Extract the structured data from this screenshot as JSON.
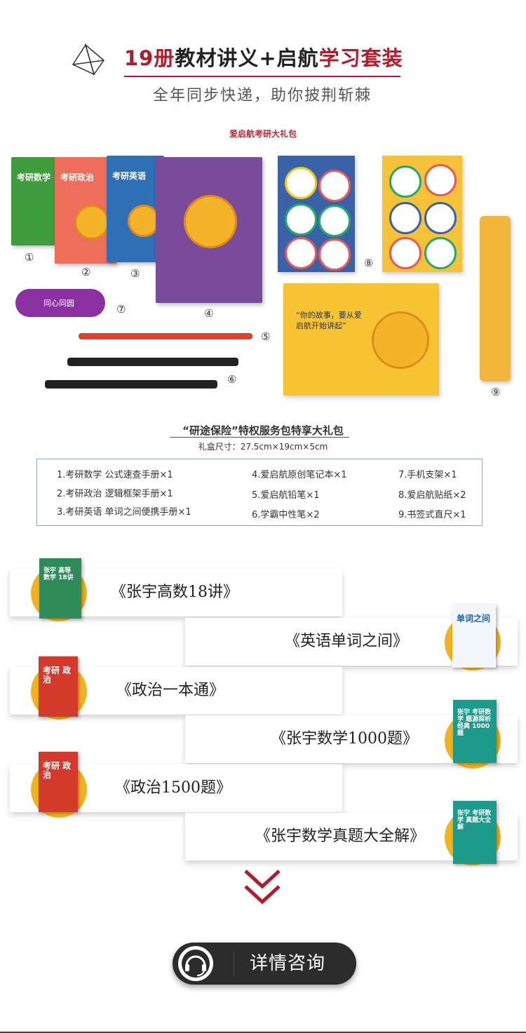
{
  "header": {
    "title_prefix": "19册",
    "title_mid": "教材讲义+启航",
    "title_suffix": "学习套装",
    "subtitle": "全年同步快递，助你披荆斩棘",
    "kit_label": "爱启航考研大礼包"
  },
  "products": {
    "book1_title": "考研数学",
    "book2_title": "考研政治",
    "book3_title": "考研英语",
    "stand_text": "同心同圆",
    "envelope_text": "“你的故事，要从爱启航开始讲起”",
    "numbers": [
      "①",
      "②",
      "③",
      "④",
      "⑤",
      "⑥",
      "⑦",
      "⑧",
      "⑨"
    ]
  },
  "gift": {
    "title": "“研途保险”特权服务包特享大礼包",
    "size": "礼盒尺寸：27.5cm×19cm×5cm",
    "items": [
      "1.考研数学 公式速查手册×1",
      "2.考研政治 逻辑框架手册×1",
      "3.考研英语 单词之间便携手册×1",
      "4.爱启航原创笔记本×1",
      "5.爱启航铅笔×1",
      "6.学霸中性笔×2",
      "7.手机支架×1",
      "8.爱启航贴纸×2",
      "9.书签式直尺×1"
    ]
  },
  "books": [
    {
      "title": "《张宇高数18讲》",
      "cover": "张宇 高等数学 18讲"
    },
    {
      "title": "《英语单词之间》",
      "cover": "单词之间"
    },
    {
      "title": "《政治一本通》",
      "cover": "考研 政治"
    },
    {
      "title": "《张宇数学1000题》",
      "cover": "张宇 考研数学 题源探析经典 1000题"
    },
    {
      "title": "《政治1500题》",
      "cover": "考研 政治"
    },
    {
      "title": "《张宇数学真题大全解》",
      "cover": "张宇 考研数学 真题大全解"
    }
  ],
  "consult": {
    "label": "详情咨询"
  },
  "colors": {
    "accent_red": "#b31a2a",
    "gold": "#f2b320",
    "button_dark": "#2c2c2c"
  }
}
